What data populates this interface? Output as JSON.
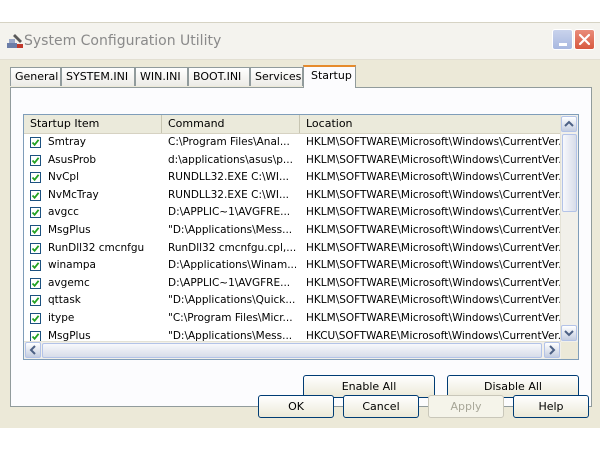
{
  "window": {
    "title": "System Configuration Utility",
    "app_icon": "msconfig-icon",
    "controls": {
      "minimize": "minimize-icon",
      "close": "close-icon"
    }
  },
  "tabs": [
    {
      "label": "General",
      "active": false
    },
    {
      "label": "SYSTEM.INI",
      "active": false
    },
    {
      "label": "WIN.INI",
      "active": false
    },
    {
      "label": "BOOT.INI",
      "active": false
    },
    {
      "label": "Services",
      "active": false
    },
    {
      "label": "Startup",
      "active": true
    }
  ],
  "startup_list": {
    "columns": [
      "Startup Item",
      "Command",
      "Location"
    ],
    "rows": [
      {
        "checked": true,
        "item": "Smtray",
        "command": "C:\\Program Files\\Anal...",
        "location": "HKLM\\SOFTWARE\\Microsoft\\Windows\\CurrentVer..."
      },
      {
        "checked": true,
        "item": "AsusProb",
        "command": "d:\\applications\\asus\\p...",
        "location": "HKLM\\SOFTWARE\\Microsoft\\Windows\\CurrentVer..."
      },
      {
        "checked": true,
        "item": "NvCpl",
        "command": "RUNDLL32.EXE C:\\WI...",
        "location": "HKLM\\SOFTWARE\\Microsoft\\Windows\\CurrentVer..."
      },
      {
        "checked": true,
        "item": "NvMcTray",
        "command": "RUNDLL32.EXE C:\\WI...",
        "location": "HKLM\\SOFTWARE\\Microsoft\\Windows\\CurrentVer..."
      },
      {
        "checked": true,
        "item": "avgcc",
        "command": "D:\\APPLIC~1\\AVGFRE...",
        "location": "HKLM\\SOFTWARE\\Microsoft\\Windows\\CurrentVer..."
      },
      {
        "checked": true,
        "item": "MsgPlus",
        "command": "\"D:\\Applications\\Mess...",
        "location": "HKLM\\SOFTWARE\\Microsoft\\Windows\\CurrentVer..."
      },
      {
        "checked": true,
        "item": "RunDll32 cmcnfgu",
        "command": "RunDll32 cmcnfgu.cpl,...",
        "location": "HKLM\\SOFTWARE\\Microsoft\\Windows\\CurrentVer..."
      },
      {
        "checked": true,
        "item": "winampa",
        "command": "D:\\Applications\\Winam...",
        "location": "HKLM\\SOFTWARE\\Microsoft\\Windows\\CurrentVer..."
      },
      {
        "checked": true,
        "item": "avgemc",
        "command": "D:\\APPLIC~1\\AVGFRE...",
        "location": "HKLM\\SOFTWARE\\Microsoft\\Windows\\CurrentVer..."
      },
      {
        "checked": true,
        "item": "qttask",
        "command": "\"D:\\Applications\\Quick...",
        "location": "HKLM\\SOFTWARE\\Microsoft\\Windows\\CurrentVer..."
      },
      {
        "checked": true,
        "item": "itype",
        "command": "\"C:\\Program Files\\Micr...",
        "location": "HKLM\\SOFTWARE\\Microsoft\\Windows\\CurrentVer..."
      },
      {
        "checked": true,
        "item": "MsgPlus",
        "command": "\"D:\\Applications\\Mess...",
        "location": "HKCU\\SOFTWARE\\Microsoft\\Windows\\CurrentVer..."
      }
    ]
  },
  "panel_buttons": {
    "enable_all": "Enable All",
    "disable_all": "Disable All"
  },
  "dialog_buttons": {
    "ok": "OK",
    "cancel": "Cancel",
    "apply": "Apply",
    "help": "Help"
  },
  "colors": {
    "dialog_bg": "#ece9d8",
    "active_tab_accent": "#e68b2c",
    "check_green": "#21a121"
  }
}
